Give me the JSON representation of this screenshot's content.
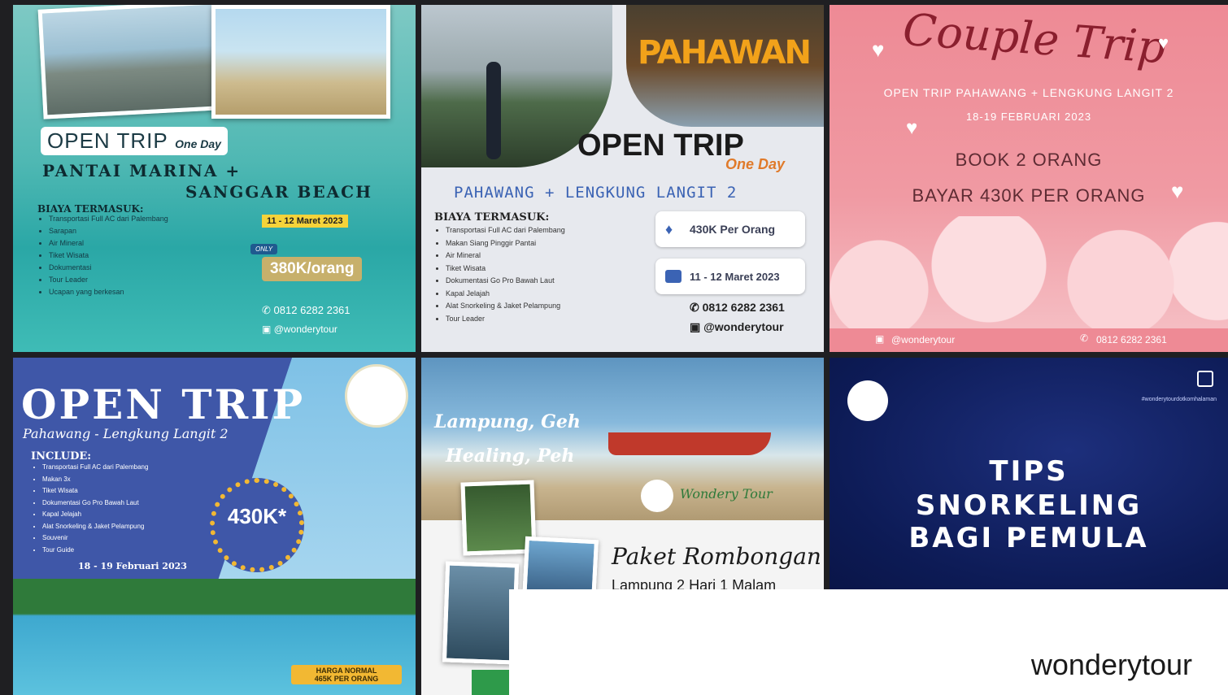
{
  "grid": {
    "tile1": {
      "open_trip": "OPEN TRIP",
      "one_day": "One Day",
      "destination_line1": "PANTAI MARINA +",
      "destination_line2": "SANGGAR BEACH",
      "includes_heading": "BIAYA TERMASUK:",
      "includes": [
        "Transportasi Full AC dari Palembang",
        "Sarapan",
        "Air Mineral",
        "Tiket Wisata",
        "Dokumentasi",
        "Tour Leader",
        "Ucapan yang berkesan"
      ],
      "date": "11 - 12 Maret 2023",
      "price_tag": "ONLY",
      "price": "380K/orang",
      "phone": "0812 6282 2361",
      "handle": "@wonderytour"
    },
    "tile2": {
      "open_trip": "OPEN TRIP",
      "one_day": "One Day",
      "banner": "PAHAWAN",
      "destination": "PAHAWANG + LENGKUNG LANGIT 2",
      "includes_heading": "BIAYA TERMASUK:",
      "includes": [
        "Transportasi Full AC dari Palembang",
        "Makan Siang Pinggir Pantai",
        "Air Mineral",
        "Tiket Wisata",
        "Dokumentasi Go Pro Bawah Laut",
        "Kapal Jelajah",
        "Alat Snorkeling & Jaket Pelampung",
        "Tour Leader"
      ],
      "price": "430K Per Orang",
      "date": "11 - 12 Maret 2023",
      "phone": "0812 6282 2361",
      "handle": "@wonderytour"
    },
    "tile3": {
      "title": "Couple Trip",
      "subtitle": "OPEN TRIP PAHAWANG + LENGKUNG LANGIT 2",
      "date": "18-19 FEBRUARI 2023",
      "book": "BOOK 2 ORANG",
      "pay": "BAYAR 430K PER ORANG",
      "handle": "@wonderytour",
      "phone": "0812 6282 2361"
    },
    "tile4": {
      "open_trip": "OPEN TRIP",
      "destination": "Pahawang - Lengkung Langit 2",
      "include_heading": "INCLUDE:",
      "includes": [
        "Transportasi Full AC dari Palembang",
        "Makan 3x",
        "Tiket Wisata",
        "Dokumentasi Go Pro Bawah Laut",
        "Kapal Jelajah",
        "Alat Snorkeling & Jaket Pelampung",
        "Souvenir",
        "Tour Guide"
      ],
      "date": "18 - 19 Februari 2023",
      "price": "430K*",
      "normal_label": "HARGA NORMAL",
      "normal_price": "465K PER ORANG"
    },
    "tile5": {
      "headline1": "Lampung, Geh",
      "headline2": "Healing, Peh",
      "brand": "Wondery Tour",
      "package": "Paket Rombongan",
      "package_sub": "Lampung 2 Hari 1 Malam"
    },
    "tile6": {
      "hashtag": "#wonderytourdotkomhalaman",
      "title_line1": "TIPS",
      "title_line2": "SNORKELING",
      "title_line3": "BAGI PEMULA"
    }
  },
  "overlay": {
    "username": "wonderytour"
  },
  "colors": {
    "teal": "#2aa7a6",
    "navy": "#0d1b56",
    "pink": "#ee8a95",
    "royal_blue": "#3f57a8",
    "accent_yellow": "#f5d33a"
  },
  "icons": [
    "whatsapp-icon",
    "instagram-icon",
    "price-tag-icon",
    "calendar-icon",
    "multiple-posts-icon",
    "heart-icon",
    "logo-badge"
  ]
}
